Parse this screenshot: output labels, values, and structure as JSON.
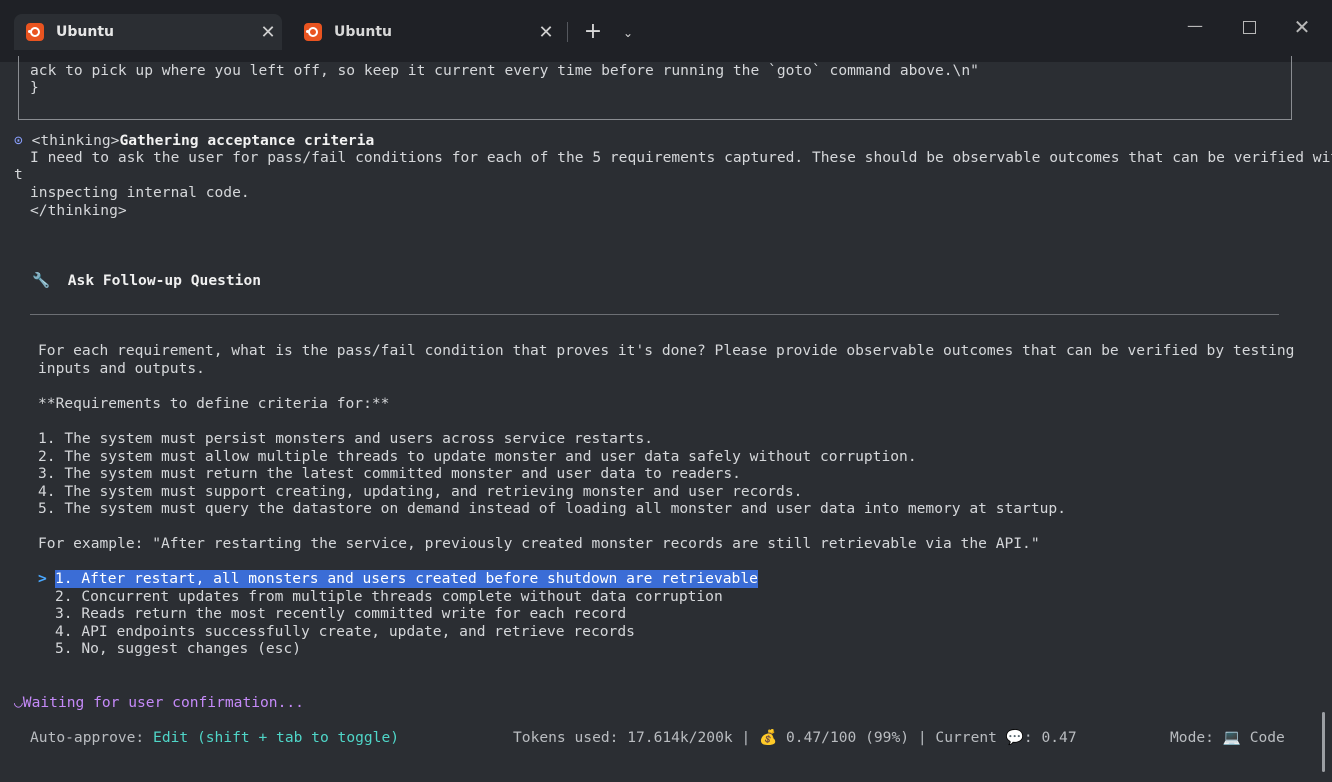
{
  "tabs": [
    {
      "title": "Ubuntu",
      "active": true,
      "close": "✕"
    },
    {
      "title": "Ubuntu",
      "active": false,
      "close": "✕"
    }
  ],
  "tabbar": {
    "new_tab": "+",
    "dropdown": "⌄"
  },
  "window": {
    "minimize": "—",
    "close": "✕"
  },
  "code_box": {
    "line1": "ack to pick up where you left off, so keep it current every time before running the `goto` command above.\\n\"",
    "line2": "}"
  },
  "thinking": {
    "bullet": "⊙",
    "open_tag": "<thinking>",
    "title": "Gathering acceptance criteria",
    "body_line1": "I need to ask the user for pass/fail conditions for each of the 5 requirements captured. These should be observable outcomes that can be verified withou",
    "body_wrap": "t",
    "body_line2": "inspecting internal code.",
    "close_tag": "</thinking>"
  },
  "tool": {
    "icon": "wrench-icon",
    "title": "Ask Follow-up Question"
  },
  "question": {
    "line1": "For each requirement, what is the pass/fail condition that proves it's done? Please provide observable outcomes that can be verified by testing",
    "line2": "inputs and outputs.",
    "req_heading": "**Requirements to define criteria for:**",
    "requirements": [
      "1. The system must persist monsters and users across service restarts.",
      "2. The system must allow multiple threads to update monster and user data safely without corruption.",
      "3. The system must return the latest committed monster and user data to readers.",
      "4. The system must support creating, updating, and retrieving monster and user records.",
      "5. The system must query the datastore on demand instead of loading all monster and user data into memory at startup."
    ],
    "example": "For example: \"After restarting the service, previously created monster records are still retrievable via the API.\""
  },
  "options": {
    "selector": ">",
    "items": [
      "1. After restart, all monsters and users created before shutdown are retrievable",
      "2. Concurrent updates from multiple threads complete without data corruption",
      "3. Reads return the most recently committed write for each record",
      "4. API endpoints successfully create, update, and retrieve records",
      "5. No, suggest changes (esc)"
    ],
    "selected_index": 0
  },
  "waiting": {
    "spinner": "◡",
    "text": "Waiting for user confirmation..."
  },
  "status": {
    "auto_approve_label": "Auto-approve:",
    "auto_approve_value": "Edit (shift + tab to toggle)",
    "tokens": "Tokens used: 17.614k/200k",
    "sep1": "|",
    "money_icon": "💰",
    "cost": "0.47/100 (99%)",
    "sep2": "|",
    "current_label": "Current",
    "chat_icon": "💬",
    "current_value": ": 0.47",
    "mode_label": "Mode:",
    "mode_icon": "💻",
    "mode_value": "Code"
  },
  "colors": {
    "terminal_bg": "#2b2e33",
    "accent_cyan": "#4fd6c8",
    "waiting_purple": "#c58af9",
    "selection_blue": "#3b6dd6"
  }
}
